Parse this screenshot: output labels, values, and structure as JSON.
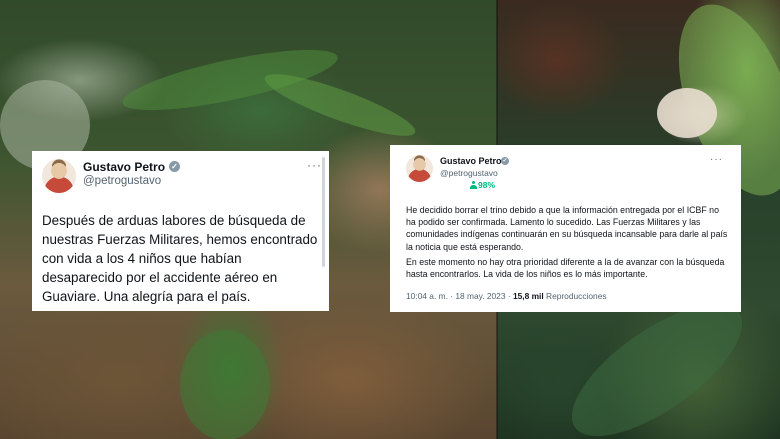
{
  "left_tweet": {
    "display_name": "Gustavo Petro",
    "handle": "@petrogustavo",
    "more": "···",
    "text": "Después de arduas labores de búsqueda de nuestras Fuerzas Militares, hemos encontrado con vida a los 4 niños que habían desaparecido por el accidente aéreo en Guaviare. Una alegría para el país."
  },
  "right_tweet": {
    "display_name": "Gustavo Petro",
    "handle": "@petrogustavo",
    "more": "···",
    "percent": "98%",
    "paragraph1": "He decidido borrar el trino debido a que la información entregada por el ICBF no ha podido ser confirmada. Lamento lo sucedido. Las Fuerzas Militares y las comunidades indígenas continuarán en su búsqueda incansable para darle al país la noticia que está esperando.",
    "paragraph2": "En este momento no hay otra prioridad diferente a la de avanzar con la búsqueda hasta encontrarlos. La vida de los niños es lo más importante.",
    "time": "10:04 a. m.",
    "separator": "·",
    "date": "18 may. 2023",
    "views_count": "15,8 mil",
    "views_label": "Reproducciones"
  },
  "icons": {
    "verified": "verified-badge-icon",
    "more": "more-options-icon",
    "avatar": "profile-avatar"
  }
}
